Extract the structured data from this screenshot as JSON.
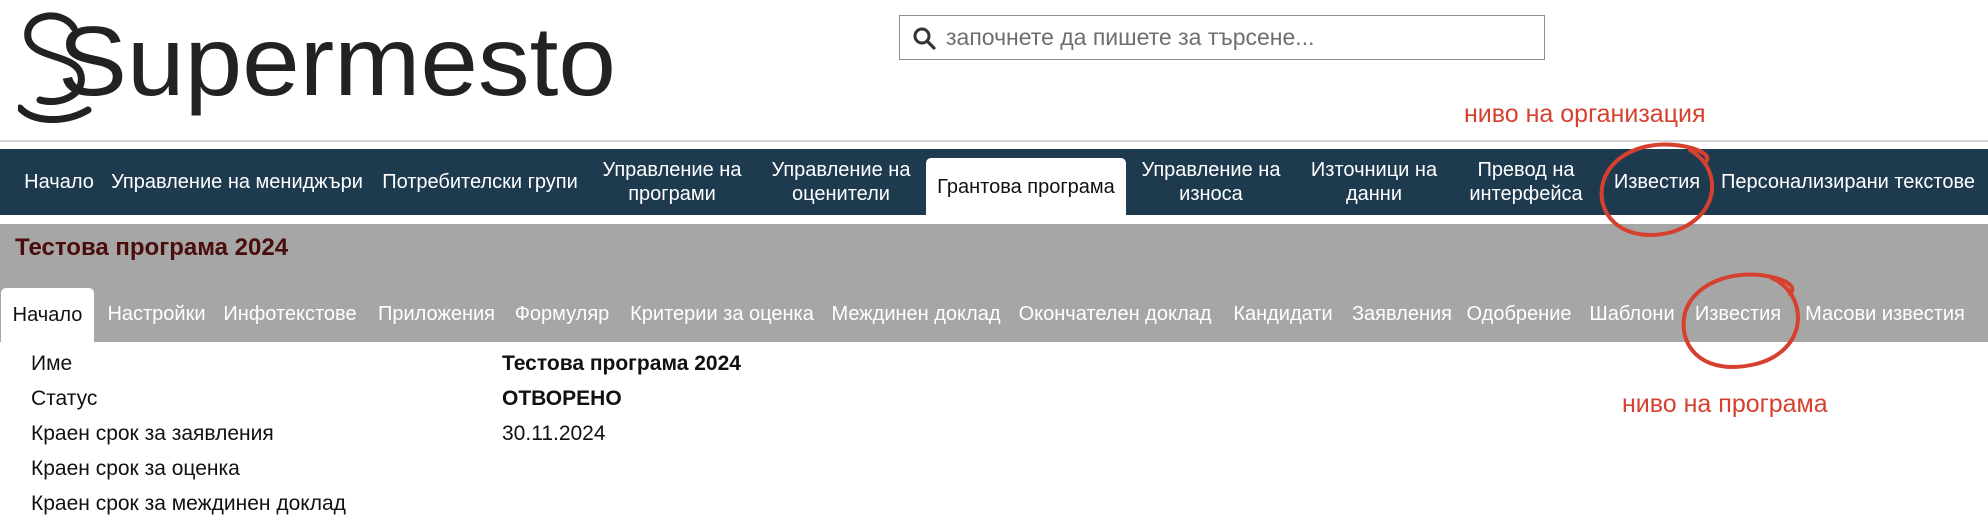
{
  "brand": {
    "logo_text": "Supermesto"
  },
  "search": {
    "placeholder": "започнете да пишете за търсене..."
  },
  "annotations": {
    "organization_level": "ниво на организация",
    "program_level": "ниво на програма"
  },
  "main_nav": {
    "items": [
      {
        "label": "Начало"
      },
      {
        "label": "Управление на мениджъри"
      },
      {
        "label": "Потребителски групи"
      },
      {
        "label": "Управление на\nпрограми"
      },
      {
        "label": "Управление на\nоценители"
      },
      {
        "label": "Грантова програма",
        "active": true
      },
      {
        "label": "Управление на\nизноса"
      },
      {
        "label": "Източници на\nданни"
      },
      {
        "label": "Превод на\nинтерфейса"
      },
      {
        "label": "Известия"
      },
      {
        "label": "Персонализирани текстове"
      }
    ]
  },
  "program": {
    "title": "Тестова програма 2024",
    "tabs": [
      {
        "label": "Начало",
        "active": true
      },
      {
        "label": "Настройки"
      },
      {
        "label": "Инфотекстове"
      },
      {
        "label": "Приложения"
      },
      {
        "label": "Формуляр"
      },
      {
        "label": "Критерии за оценка"
      },
      {
        "label": "Междинен доклад"
      },
      {
        "label": "Окончателен доклад"
      },
      {
        "label": "Кандидати"
      },
      {
        "label": "Заявления"
      },
      {
        "label": "Одобрение"
      },
      {
        "label": "Шаблони"
      },
      {
        "label": "Известия"
      },
      {
        "label": "Масови известия"
      }
    ]
  },
  "details": {
    "rows": [
      {
        "label": "Име",
        "value": "Тестова програма 2024",
        "bold": true
      },
      {
        "label": "Статус",
        "value": "ОТВОРЕНО",
        "bold": true
      },
      {
        "label": "Краен срок за заявления",
        "value": "30.11.2024",
        "bold": false
      },
      {
        "label": "Краен срок за оценка",
        "value": "",
        "bold": false
      },
      {
        "label": "Краен срок за междинен доклад",
        "value": "",
        "bold": false
      }
    ]
  },
  "colors": {
    "nav_background": "#1e3a4e",
    "program_bar": "#a6a6a6",
    "program_title": "#4a0c0c",
    "annotation": "#d6402f"
  }
}
